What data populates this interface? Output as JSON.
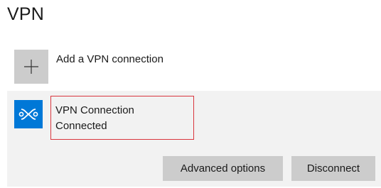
{
  "page": {
    "title": "VPN"
  },
  "add_connection": {
    "label": "Add a VPN connection",
    "icon": "plus-icon"
  },
  "connection": {
    "icon": "vpn-icon",
    "name": "VPN Connection",
    "status": "Connected",
    "buttons": {
      "advanced_label": "Advanced options",
      "disconnect_label": "Disconnect"
    }
  },
  "colors": {
    "accent": "#0078d7",
    "tile_gray": "#cccccc",
    "panel_bg": "#f2f2f2",
    "highlight_border": "#d9363e"
  }
}
